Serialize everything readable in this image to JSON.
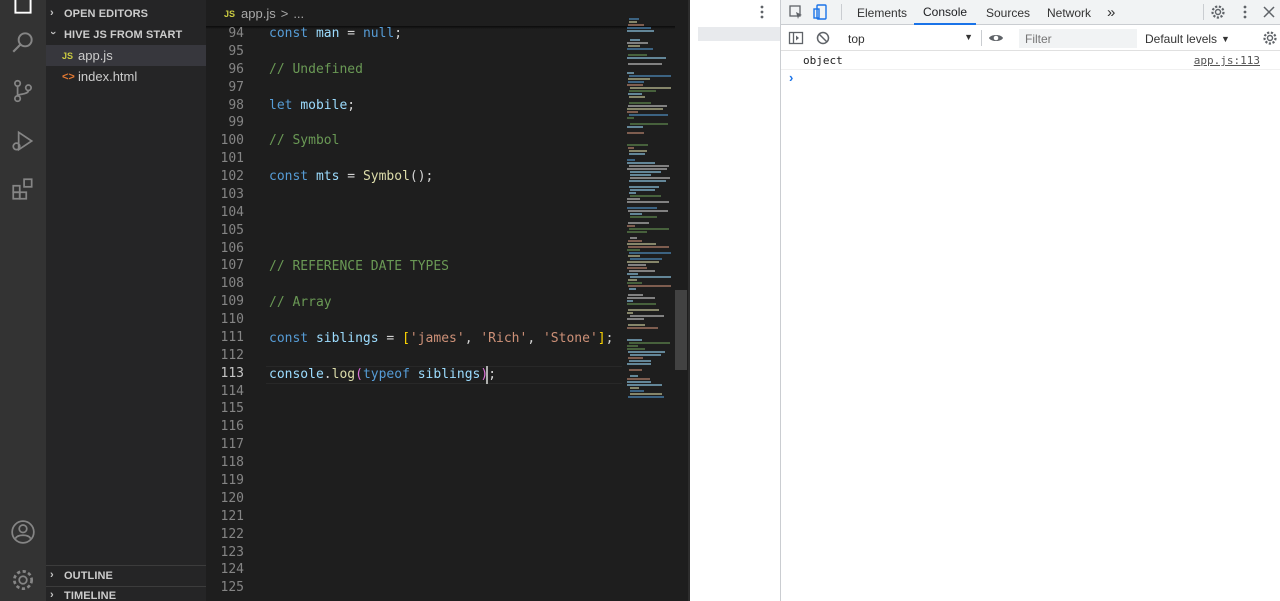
{
  "sidebar": {
    "open_editors_label": "OPEN EDITORS",
    "project_label": "HIVE JS FROM START",
    "files": [
      {
        "icon": "JS",
        "name": "app.js",
        "active": true
      },
      {
        "icon": "<>",
        "name": "index.html",
        "active": false
      }
    ],
    "outline_label": "OUTLINE",
    "timeline_label": "TIMELINE"
  },
  "editor": {
    "breadcrumb_icon": "JS",
    "breadcrumb_file": "app.js",
    "breadcrumb_sep": ">",
    "breadcrumb_more": "...",
    "line_numbers": [
      "94",
      "95",
      "96",
      "97",
      "98",
      "99",
      "100",
      "101",
      "102",
      "103",
      "104",
      "105",
      "106",
      "107",
      "108",
      "109",
      "110",
      "111",
      "112",
      "113",
      "114",
      "115",
      "116",
      "117",
      "118",
      "119",
      "120",
      "121",
      "122",
      "123",
      "124",
      "125"
    ],
    "current_line": "113",
    "code": {
      "l94": {
        "kw": "const",
        "var": "man",
        "op": " = ",
        "val": "null",
        "end": ";"
      },
      "l96": "// Undefined",
      "l98": {
        "kw": "let",
        "var": "mobile",
        "end": ";"
      },
      "l100": "// Symbol",
      "l102": {
        "kw": "const",
        "var": "mts",
        "op": " = ",
        "fn": "Symbol",
        "end": "();"
      },
      "l107": "// REFERENCE DATE TYPES",
      "l109": "// Array",
      "l111": {
        "kw": "const",
        "var": "siblings",
        "op": " = ",
        "open": "[",
        "s1": "'james'",
        "s2": "'Rich'",
        "s3": "'Stone'",
        "close": "]",
        "end": ";"
      },
      "l113": {
        "obj": "console",
        "dot": ".",
        "fn": "log",
        "open": "(",
        "kw": "typeof",
        "var": "siblings",
        "close": ")",
        "end": ";"
      }
    }
  },
  "devtools": {
    "tabs": [
      "Elements",
      "Console",
      "Sources",
      "Network"
    ],
    "active_tab": "Console",
    "more_tabs": "»",
    "context": "top",
    "filter_placeholder": "Filter",
    "levels": "Default levels",
    "levels_arrow": "▼",
    "context_arrow": "▼",
    "log_message": "object",
    "log_source": "app.js:113",
    "prompt": "›"
  }
}
